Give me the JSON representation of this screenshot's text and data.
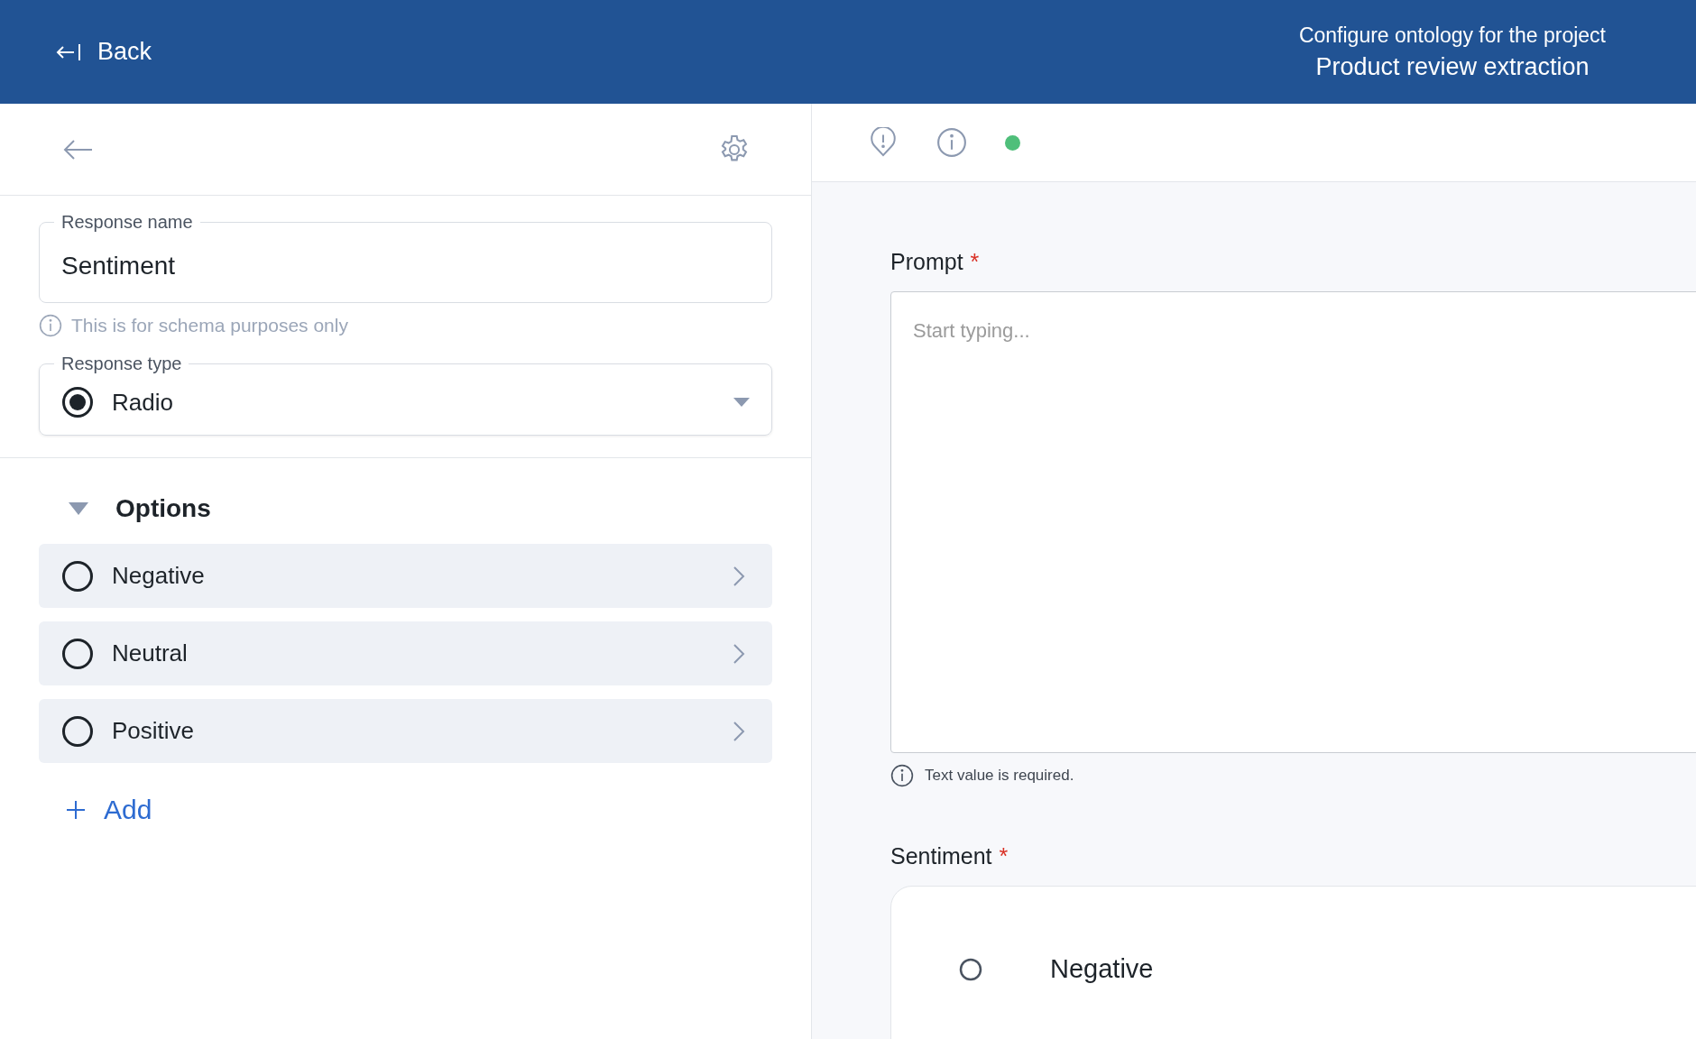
{
  "header": {
    "back": "Back",
    "subtitle": "Configure ontology for the project",
    "title": "Product review extraction"
  },
  "editor": {
    "response_name": {
      "label": "Response name",
      "value": "Sentiment",
      "hint": "This is for schema purposes only"
    },
    "response_type": {
      "label": "Response type",
      "value": "Radio"
    },
    "options": {
      "title": "Options",
      "expanded": true,
      "items": [
        {
          "label": "Negative"
        },
        {
          "label": "Neutral"
        },
        {
          "label": "Positive"
        }
      ],
      "add": "Add"
    }
  },
  "preview": {
    "prompt": {
      "label": "Prompt",
      "required": "*",
      "placeholder": "Start typing...",
      "error": "Text value is required."
    },
    "sentiment": {
      "label": "Sentiment",
      "required": "*",
      "options": [
        {
          "label": "Negative",
          "selected": false
        }
      ]
    }
  }
}
